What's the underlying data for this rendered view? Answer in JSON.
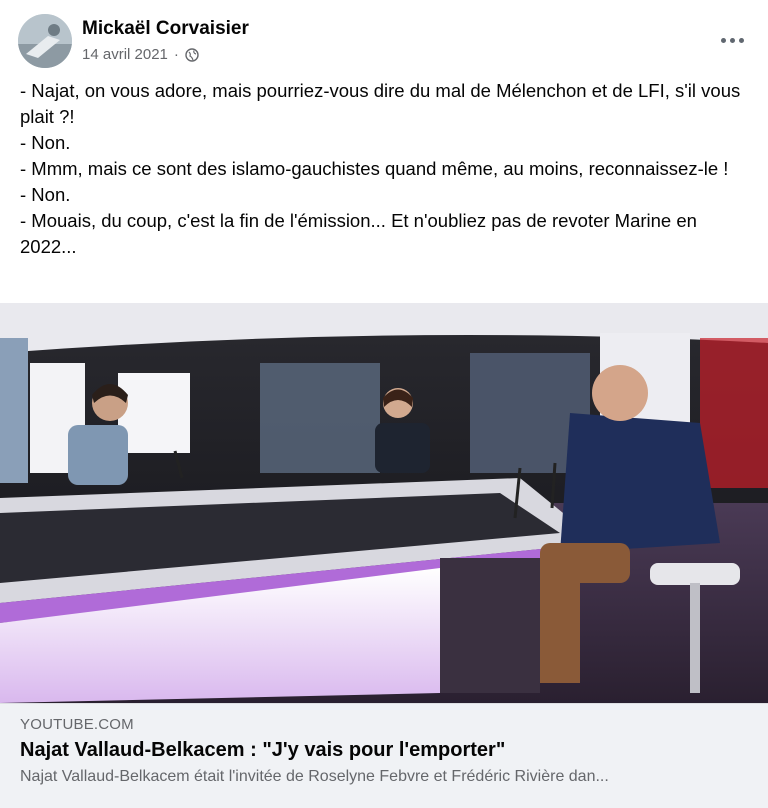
{
  "post": {
    "author": "Mickaël Corvaisier",
    "date": "14 avril 2021",
    "separator": "·",
    "privacy_icon": "globe-icon",
    "more_icon": "more-options-icon",
    "lines": [
      "- Najat, on vous adore, mais pourriez-vous dire du mal de Mélenchon et de LFI, s'il vous plait ?!",
      "- Non.",
      "- Mmm, mais ce sont des islamo-gauchistes quand même, au moins, reconnaissez-le !",
      "- Non.",
      "- Mouais, du coup, c'est la fin de l'émission... Et n'oubliez pas de revoter Marine en 2022..."
    ]
  },
  "link": {
    "domain": "YOUTUBE.COM",
    "title": "Najat Vallaud-Belkacem : \"J'y vais pour l'emporter\"",
    "description": "Najat Vallaud-Belkacem était l'invitée de Roselyne Febvre et Frédéric Rivière dan..."
  }
}
